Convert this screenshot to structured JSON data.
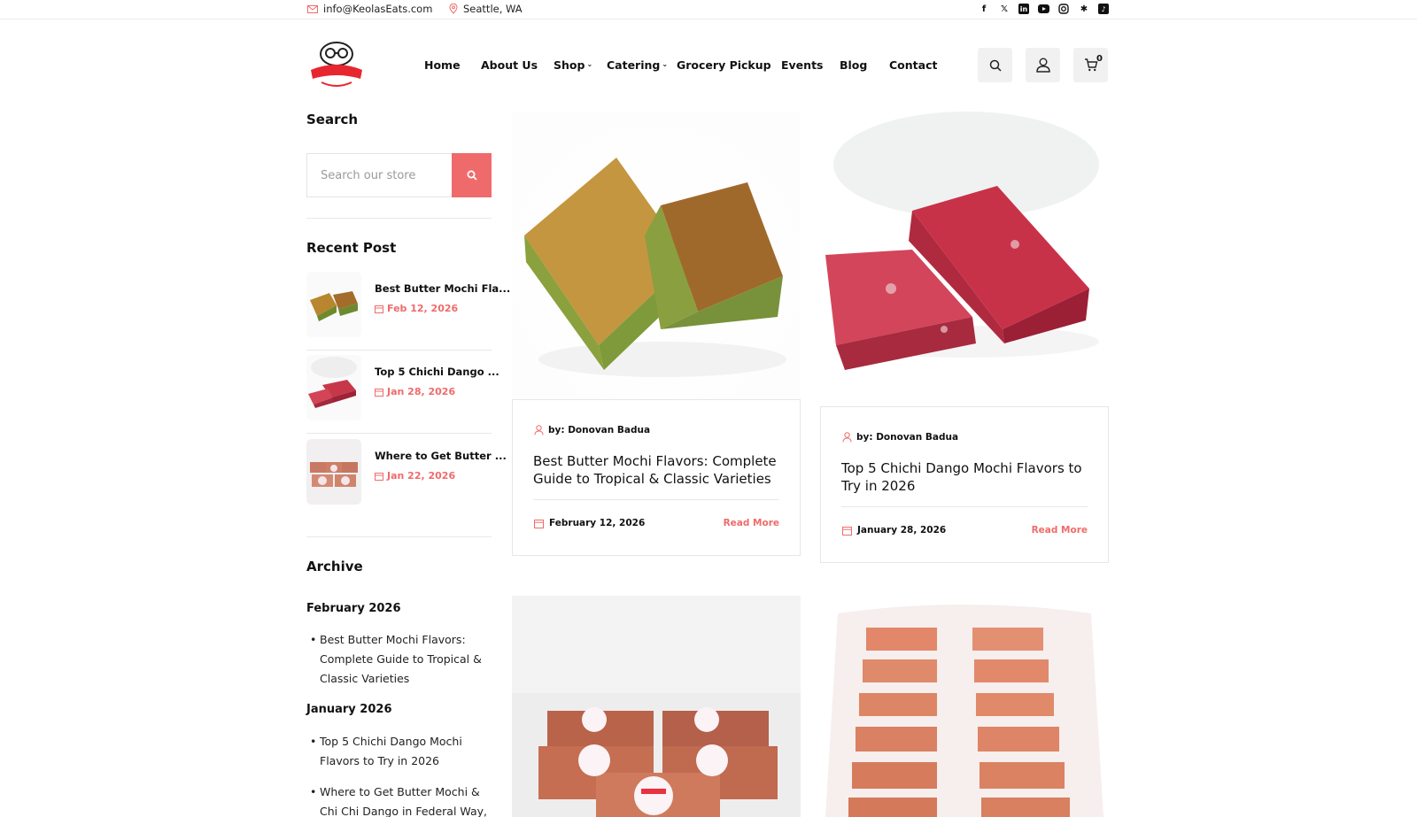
{
  "topbar": {
    "email": "info@KeolasEats.com",
    "location": "Seattle, WA",
    "socials": [
      "facebook-icon",
      "x-icon",
      "linkedin-icon",
      "youtube-icon",
      "instagram-icon",
      "yelp-icon",
      "tiktok-icon"
    ]
  },
  "nav": {
    "items": [
      {
        "label": "Home"
      },
      {
        "label": "About Us"
      },
      {
        "label": "Shop",
        "dropdown": true
      },
      {
        "label": "Catering",
        "dropdown": true
      },
      {
        "label": "Grocery Pickup"
      },
      {
        "label": "Events"
      },
      {
        "label": "Blog"
      },
      {
        "label": "Contact"
      }
    ],
    "cart_count": "0"
  },
  "sidebar": {
    "search_heading": "Search",
    "search_placeholder": "Search our store",
    "recent_heading": "Recent Post",
    "recent": [
      {
        "title": "Best Butter Mochi Fla...",
        "date": "Feb 12, 2026"
      },
      {
        "title": "Top 5 Chichi Dango ...",
        "date": "Jan 28, 2026"
      },
      {
        "title": "Where to Get Butter ...",
        "date": "Jan 22, 2026"
      }
    ],
    "archive_heading": "Archive",
    "archive": [
      {
        "month": "February 2026",
        "posts": [
          "Best Butter Mochi Flavors: Complete Guide to Tropical & Classic Varieties"
        ]
      },
      {
        "month": "January 2026",
        "posts": [
          "Top 5 Chichi Dango Mochi Flavors to Try in 2026",
          "Where to Get Butter Mochi & Chi Chi Dango in Federal Way,"
        ]
      }
    ]
  },
  "posts": [
    {
      "author": "by: Donovan Badua",
      "title": "Best Butter Mochi Flavors: Complete Guide to Tropical & Classic Varieties",
      "date": "February 12, 2026",
      "read_more": "Read More"
    },
    {
      "author": "by: Donovan Badua",
      "title": "Top 5 Chichi Dango Mochi Flavors to Try in 2026",
      "date": "January 28, 2026",
      "read_more": "Read More"
    }
  ],
  "colors": {
    "accent": "#ef6b6b",
    "text": "#111111",
    "border": "#e6e6e6"
  }
}
